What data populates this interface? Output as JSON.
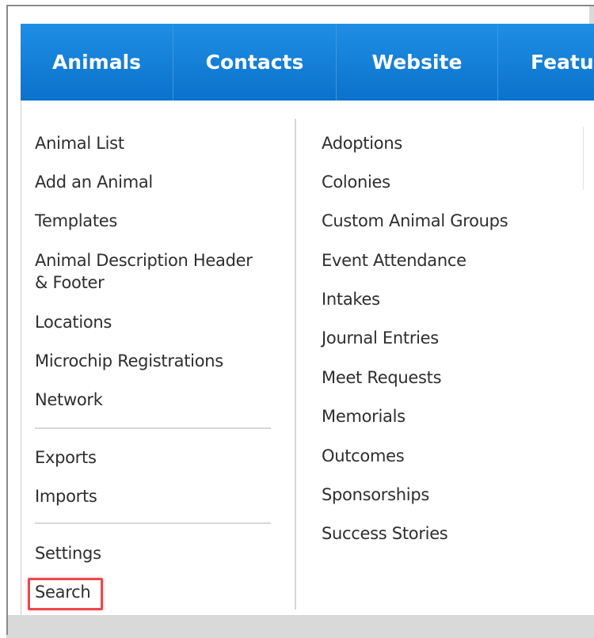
{
  "nav": {
    "tabs": [
      {
        "label": "Animals"
      },
      {
        "label": "Contacts"
      },
      {
        "label": "Website"
      },
      {
        "label": "Featu"
      }
    ]
  },
  "menu": {
    "left_group1": [
      {
        "label": "Animal List"
      },
      {
        "label": "Add an Animal"
      },
      {
        "label": "Templates"
      },
      {
        "label": "Animal Description Header"
      },
      {
        "label": "& Footer"
      },
      {
        "label": "Locations"
      },
      {
        "label": "Microchip Registrations"
      },
      {
        "label": "Network"
      }
    ],
    "left_group2": [
      {
        "label": "Exports"
      },
      {
        "label": "Imports"
      }
    ],
    "left_group3": [
      {
        "label": "Settings"
      },
      {
        "label": "Search"
      }
    ],
    "right": [
      {
        "label": "Adoptions"
      },
      {
        "label": "Colonies"
      },
      {
        "label": "Custom Animal Groups"
      },
      {
        "label": "Event Attendance"
      },
      {
        "label": "Intakes"
      },
      {
        "label": "Journal Entries"
      },
      {
        "label": "Meet Requests"
      },
      {
        "label": "Memorials"
      },
      {
        "label": "Outcomes"
      },
      {
        "label": "Sponsorships"
      },
      {
        "label": "Success Stories"
      }
    ]
  },
  "colors": {
    "nav_blue": "#0b72cc",
    "highlight_red": "#e8494f"
  }
}
